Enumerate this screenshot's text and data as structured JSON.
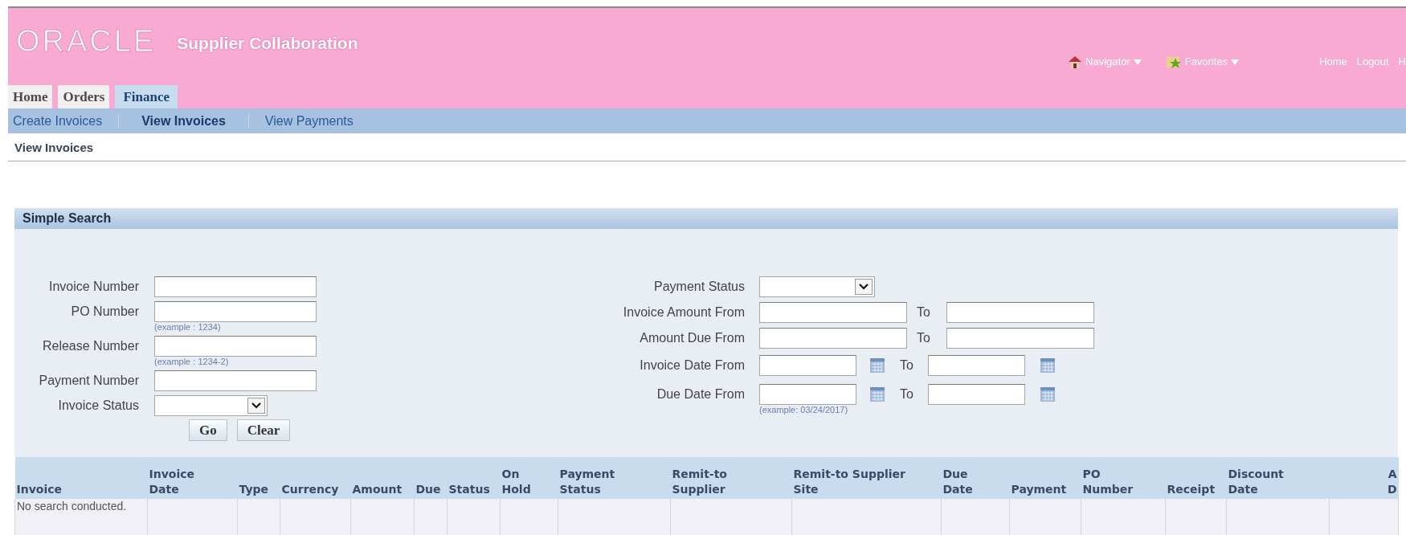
{
  "header": {
    "logo": "ORACLE",
    "title": "Supplier Collaboration",
    "menus": [
      {
        "label": "Navigator",
        "kind": "house"
      },
      {
        "label": "Favorites",
        "kind": "star"
      }
    ],
    "links": [
      "Home",
      "Logout",
      "H"
    ]
  },
  "tabs": [
    {
      "label": "Home",
      "selected": false
    },
    {
      "label": "Orders",
      "selected": false
    },
    {
      "label": "Finance",
      "selected": true
    }
  ],
  "subtabs": [
    {
      "label": "Create Invoices",
      "selected": false
    },
    {
      "label": "View Invoices",
      "selected": true
    },
    {
      "label": "View Payments",
      "selected": false
    }
  ],
  "page_title": "View Invoices",
  "search": {
    "title": "Simple Search",
    "left_fields": [
      {
        "label": "Invoice Number",
        "kind": "text"
      },
      {
        "label": "PO Number",
        "kind": "text",
        "hint": "(example : 1234)"
      },
      {
        "label": "Release Number",
        "kind": "text",
        "hint": "(example : 1234-2)"
      },
      {
        "label": "Payment Number",
        "kind": "text"
      },
      {
        "label": "Invoice Status",
        "kind": "select"
      }
    ],
    "buttons": [
      "Go",
      "Clear"
    ],
    "right_fields": [
      {
        "label": "Payment Status",
        "kind": "select"
      },
      {
        "label": "Invoice Amount From",
        "kind": "range",
        "to": "To"
      },
      {
        "label": "Amount Due From",
        "kind": "range",
        "to": "To"
      },
      {
        "label": "Invoice Date From",
        "kind": "date_range",
        "to": "To"
      },
      {
        "label": "Due Date From",
        "kind": "date_range",
        "to": "To",
        "hint": "(example: 03/24/2017)"
      }
    ]
  },
  "table": {
    "columns": [
      {
        "lines": [
          "Invoice"
        ]
      },
      {
        "lines": [
          "Invoice",
          "Date"
        ]
      },
      {
        "lines": [
          "Type"
        ]
      },
      {
        "lines": [
          "Currency"
        ]
      },
      {
        "lines": [
          "Amount"
        ]
      },
      {
        "lines": [
          "Due"
        ]
      },
      {
        "lines": [
          "Status"
        ]
      },
      {
        "lines": [
          "On",
          "Hold"
        ]
      },
      {
        "lines": [
          "Payment",
          "Status"
        ]
      },
      {
        "lines": [
          "Remit-to",
          "Supplier"
        ]
      },
      {
        "lines": [
          "Remit-to Supplier",
          "Site"
        ]
      },
      {
        "lines": [
          "Due",
          "Date"
        ]
      },
      {
        "lines": [
          "Payment"
        ]
      },
      {
        "lines": [
          "PO",
          "Number"
        ]
      },
      {
        "lines": [
          "Receipt"
        ]
      },
      {
        "lines": [
          "Discount",
          "Date"
        ]
      },
      {
        "lines": [
          "A",
          "D"
        ]
      }
    ],
    "rows": [
      {
        "cells": [
          "No search conducted."
        ]
      }
    ]
  }
}
